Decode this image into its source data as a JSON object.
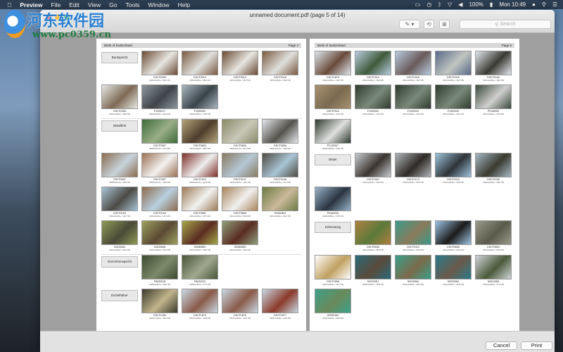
{
  "menubar": {
    "apple": "",
    "items": [
      "Preview",
      "File",
      "Edit",
      "View",
      "Go",
      "Tools",
      "Window",
      "Help"
    ],
    "battery": "100%",
    "clock": "Mon 10:49"
  },
  "window": {
    "title": "unnamed document.pdf (page 5 of 14)",
    "search_placeholder": "Search",
    "cancel": "Cancel",
    "print": "Print"
  },
  "watermark": {
    "name": "河东软件园",
    "url": "www.pc0359.cn"
  },
  "pages": [
    {
      "header": "Birds of Switzerland",
      "page": "Page 4",
      "rows": [
        {
          "label": "Buntspecht",
          "thumbs": [
            [
              "DSCF2909",
              "3264x2448px / 3631 KB",
              "#6b4a33",
              "#e6e6e0"
            ],
            [
              "DSCF2912",
              "3264x2448px / 3564 KB",
              "#7a5a40",
              "#e0e0dc"
            ],
            [
              "DSCF2913",
              "3264x2448px / 3573 KB",
              "#6b4a33",
              "#e6e6e0"
            ],
            [
              "DSCF2918",
              "3264x2448px / 3492 KB",
              "#7a5a40",
              "#e0e0dc"
            ]
          ]
        },
        {
          "thumbs": [
            [
              "DSCF2955",
              "3264x2448px / 3593 KB",
              "#e8e8e4",
              "#7d6a55"
            ],
            [
              "P1000017",
              "4608x3456px / 3030 KB",
              "#8e979d",
              "#3e4448"
            ],
            [
              "P1000022",
              "4608x3456px / 1159 KB",
              "#a9b7bf",
              "#39434a"
            ]
          ]
        },
        {
          "sep": true,
          "label": "Distelfink",
          "thumbs": [
            [
              "DSCF0057",
              "4608x3072px / 3570 KB",
              "#3e6b3a",
              "#9aae88"
            ],
            [
              "DSCF0803",
              "3264x2448px / 3804 KB",
              "#b5a47a",
              "#4d3d2c"
            ],
            [
              "DSCF0840",
              "4608x3072px / 4019 KB",
              "#8a8a6a",
              "#c8c8b8"
            ],
            [
              "DSCF0806",
              "4608x3072px / 4006 KB",
              "#e4e6ea",
              "#55534d"
            ]
          ]
        },
        {
          "thumbs": [
            [
              "DSCF0937",
              "4608x3072px / 4662 KB",
              "#8c6c4f",
              "#c7d4dc"
            ],
            [
              "DSCF1007",
              "4608x3072px / 4520 KB",
              "#9c6f52",
              "#f2f2f2"
            ],
            [
              "DSCF1013",
              "4608x3072px / 4249 KB",
              "#7e2e28",
              "#eeeeee"
            ],
            [
              "DSCF3121",
              "3264x2448px / 1241 KB",
              "#8a7a60",
              "#b5c8d6"
            ],
            [
              "DSCF3148",
              "3264x2448px / 1470 KB",
              "#4d4a40",
              "#a9c5d6"
            ]
          ]
        },
        {
          "thumbs": [
            [
              "DSCF3153",
              "3264x2448px / 1327 KB",
              "#a8c4d8",
              "#4d4a44"
            ],
            [
              "DSCF3154",
              "3264x2448px / 1470 KB",
              "#8d6b4c",
              "#b8d0e0"
            ],
            [
              "DSCF3851",
              "3264x2448px / 3373 KB",
              "#9d7a55",
              "#f2f2f2"
            ],
            [
              "DSCF3856",
              "3264x2448px / 3040 KB",
              "#a9845a",
              "#f0f0f0"
            ],
            [
              "S0020804",
              "3264x2448px / 3427 KB",
              "#6d7a44",
              "#c9b99a"
            ]
          ]
        },
        {
          "thumbs": [
            [
              "S0020843",
              "3264x2448px / 3513 KB",
              "#8e9a55",
              "#4a4a38"
            ],
            [
              "S0020848",
              "3264x2448px / 3415 KB",
              "#9ea060",
              "#5a4a33"
            ],
            [
              "S0080850",
              "3264x2448px / 3382 KB",
              "#a7a84a",
              "#5a2c22"
            ],
            [
              "S0080859",
              "3264x2448px / 3424 KB",
              "#8fa07a",
              "#5a2c22"
            ]
          ]
        },
        {
          "sep": true,
          "label": "Dreizehenspecht",
          "thumbs": [
            [
              "P8030018",
              "4608x3456px / 3647 KB",
              "#3c4a30",
              "#7d8a6a"
            ],
            [
              "P8030023",
              "4608x3456px / 3775 KB",
              "#4a5538",
              "#a0a890"
            ]
          ]
        },
        {
          "label": "Eichelhäher",
          "thumbs": [
            [
              "DSCF1284",
              "3264x1718px / 3513 KB",
              "#3c3a2e",
              "#c0b48a"
            ],
            [
              "DSCF1874",
              "3264x2448px / 1668 KB",
              "#c8d8e4",
              "#8a5a48"
            ],
            [
              "DSCF1875",
              "3264x2448px / 1341 KB",
              "#c8d8e4",
              "#8a5a48"
            ],
            [
              "DSCF1877",
              "3264x2448px / 1384 KB",
              "#c8d8e4",
              "#8a3a2a"
            ]
          ]
        }
      ]
    },
    {
      "header": "Birds of Switzerland",
      "page": "Page 5",
      "rows": [
        {
          "thumbs": [
            [
              "DSCF1879",
              "3264x2448px / 1461 KB",
              "#dde6ec",
              "#6a4a3a"
            ],
            [
              "DSCF1914",
              "3264x2448px / 1536 KB",
              "#b8cde0",
              "#3f5a3a"
            ],
            [
              "DSCF1915",
              "3264x2448px / 1567 KB",
              "#b8cde0",
              "#6a5a5a"
            ],
            [
              "DSCF1916",
              "3264x2448px / 1547 KB",
              "#5a6a8a",
              "#c0c6c0"
            ],
            [
              "DSCF2184",
              "3264x2448px / 1502 KB",
              "#e4e8ec",
              "#3a3a34"
            ]
          ]
        },
        {
          "thumbs": [
            [
              "DSCF2914",
              "3264x2448px / 4126 KB",
              "#a89070",
              "#7a6a50"
            ],
            [
              "P1200032",
              "3264x2448px / 1135 KB",
              "#2e3a2e",
              "#7a8a7a"
            ],
            [
              "P1200034",
              "3264x2448px / 1016 KB",
              "#2e3a2e",
              "#7a8a7a"
            ],
            [
              "P1200040",
              "3264x2448px / 1037 KB",
              "#2e3a2e",
              "#7a8a7a"
            ],
            [
              "P2130005",
              "3264x2448px / 3766 KB",
              "#3a4a3a",
              "#d0d0d0"
            ]
          ]
        },
        {
          "thumbs": [
            [
              "P2130007",
              "4608x3456px / 4031 KB",
              "#2e3a2e",
              "#e0e0e0"
            ]
          ]
        },
        {
          "label": "Elster",
          "thumbs": [
            [
              "DSCF2167",
              "3264x2448px / 2036 KB",
              "#c8ccd0",
              "#3a3430"
            ],
            [
              "DSCF2173",
              "3264x2448px / 3576 KB",
              "#b0b4b8",
              "#2e2a26"
            ],
            [
              "DSCF2210",
              "3264x2448px / 2236 KB",
              "#9dc4dc",
              "#2e3438"
            ],
            [
              "DSCF2236",
              "3264x2448px / 4351 KB",
              "#a6b8c4",
              "#3a3a30"
            ]
          ]
        },
        {
          "thumbs": [
            [
              "P5160026",
              "4608x3456px / 2766 KB",
              "#9ab4c8",
              "#2a3440"
            ]
          ]
        },
        {
          "label": "Erlenzeisig",
          "thumbs": [
            [
              "DSCF0046",
              "3264x2448px / 3638 KB",
              "#b08040",
              "#5a7a3a"
            ],
            [
              "DSCF0110",
              "3264x2448px / 3450 KB",
              "#3a9a8a",
              "#8a7a5a"
            ],
            [
              "DSCF0638",
              "3264x2448px / 3102 KB",
              "#9dc4e4",
              "#1a1a1a"
            ],
            [
              "DSCF0853",
              "3264x2448px / 3952 KB",
              "#9a9a8a",
              "#5a5a4a"
            ]
          ]
        },
        {
          "thumbs": [
            [
              "DSCF2698",
              "3264x2448px / 2317 KB",
              "#ffffff",
              "#c0a060"
            ],
            [
              "S0010051",
              "3264x2448px / 3836 KB",
              "#2a6a7a",
              "#5a4a3a"
            ],
            [
              "S0010066",
              "3264x2448px / 3953 KB",
              "#3aa08a",
              "#7a6a4a"
            ],
            [
              "S0020062",
              "3264x2448px / 4345 KB",
              "#2a7a8a",
              "#6a5a4a"
            ],
            [
              "S0041058",
              "3264x2448px / 3713 KB",
              "#d0d4d8",
              "#4a5a3a"
            ]
          ]
        },
        {
          "thumbs": [
            [
              "S0090150",
              "3264x2448px / 3480 KB",
              "#3aa08a",
              "#6a8a5a"
            ]
          ]
        }
      ]
    }
  ]
}
